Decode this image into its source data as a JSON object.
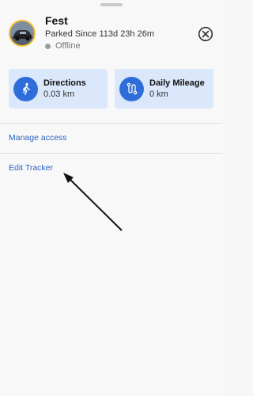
{
  "tracker": {
    "name": "Fest",
    "parked": "Parked Since 113d 23h 26m",
    "status": "Offline"
  },
  "cards": [
    {
      "label": "Directions",
      "value": "0.03 km",
      "icon": "walking-person-icon"
    },
    {
      "label": "Daily Mileage",
      "value": "0 km",
      "icon": "route-icon"
    }
  ],
  "menu": {
    "manage_access": "Manage access",
    "edit_tracker": "Edit Tracker"
  },
  "colors": {
    "accent": "#2f6ed8",
    "card_bg": "#dbe8fb",
    "link": "#2e63c0",
    "avatar_border": "#f1c232"
  }
}
